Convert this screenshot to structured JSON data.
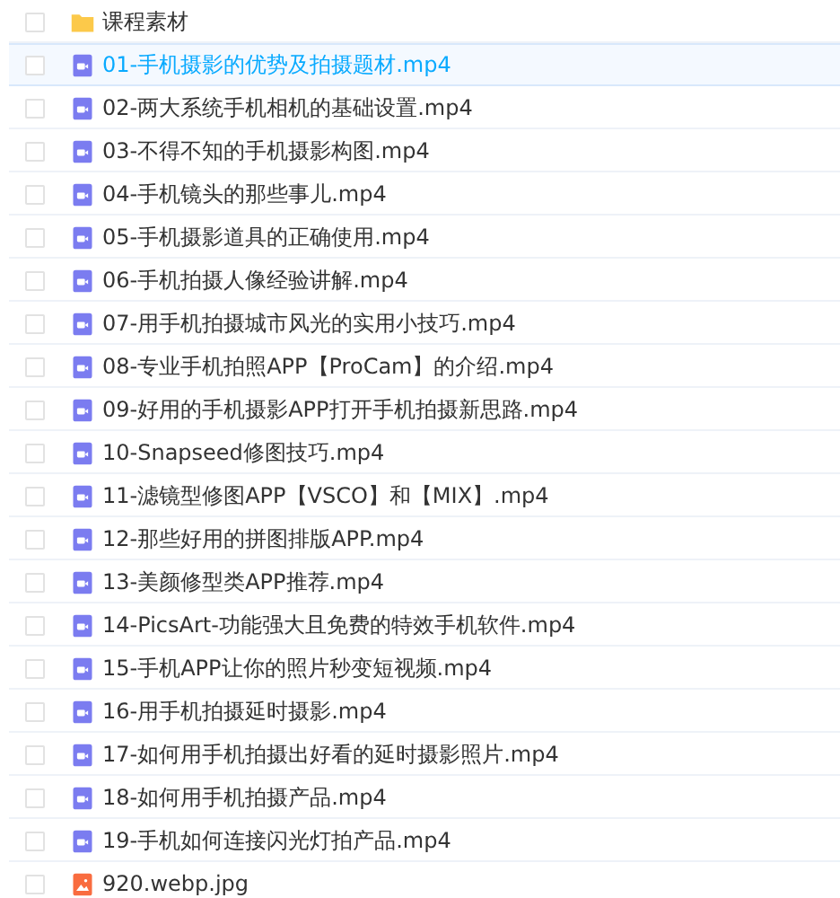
{
  "files": [
    {
      "kind": "folder",
      "name": "课程素材",
      "selected": false,
      "checked": false
    },
    {
      "kind": "video",
      "name": "01-手机摄影的优势及拍摄题材.mp4",
      "selected": true,
      "checked": false
    },
    {
      "kind": "video",
      "name": "02-两大系统手机相机的基础设置.mp4",
      "selected": false,
      "checked": false
    },
    {
      "kind": "video",
      "name": "03-不得不知的手机摄影构图.mp4",
      "selected": false,
      "checked": false
    },
    {
      "kind": "video",
      "name": "04-手机镜头的那些事儿.mp4",
      "selected": false,
      "checked": false
    },
    {
      "kind": "video",
      "name": "05-手机摄影道具的正确使用.mp4",
      "selected": false,
      "checked": false
    },
    {
      "kind": "video",
      "name": "06-手机拍摄人像经验讲解.mp4",
      "selected": false,
      "checked": false
    },
    {
      "kind": "video",
      "name": "07-用手机拍摄城市风光的实用小技巧.mp4",
      "selected": false,
      "checked": false
    },
    {
      "kind": "video",
      "name": "08-专业手机拍照APP【ProCam】的介绍.mp4",
      "selected": false,
      "checked": false
    },
    {
      "kind": "video",
      "name": "09-好用的手机摄影APP打开手机拍摄新思路.mp4",
      "selected": false,
      "checked": false
    },
    {
      "kind": "video",
      "name": "10-Snapseed修图技巧.mp4",
      "selected": false,
      "checked": false
    },
    {
      "kind": "video",
      "name": "11-滤镜型修图APP【VSCO】和【MIX】.mp4",
      "selected": false,
      "checked": false
    },
    {
      "kind": "video",
      "name": "12-那些好用的拼图排版APP.mp4",
      "selected": false,
      "checked": false
    },
    {
      "kind": "video",
      "name": "13-美颜修型类APP推荐.mp4",
      "selected": false,
      "checked": false
    },
    {
      "kind": "video",
      "name": "14-PicsArt-功能强大且免费的特效手机软件.mp4",
      "selected": false,
      "checked": false
    },
    {
      "kind": "video",
      "name": "15-手机APP让你的照片秒变短视频.mp4",
      "selected": false,
      "checked": false
    },
    {
      "kind": "video",
      "name": "16-用手机拍摄延时摄影.mp4",
      "selected": false,
      "checked": false
    },
    {
      "kind": "video",
      "name": "17-如何用手机拍摄出好看的延时摄影照片.mp4",
      "selected": false,
      "checked": false
    },
    {
      "kind": "video",
      "name": "18-如何用手机拍摄产品.mp4",
      "selected": false,
      "checked": false
    },
    {
      "kind": "video",
      "name": "19-手机如何连接闪光灯拍产品.mp4",
      "selected": false,
      "checked": false
    },
    {
      "kind": "image",
      "name": "920.webp.jpg",
      "selected": false,
      "checked": false
    }
  ]
}
